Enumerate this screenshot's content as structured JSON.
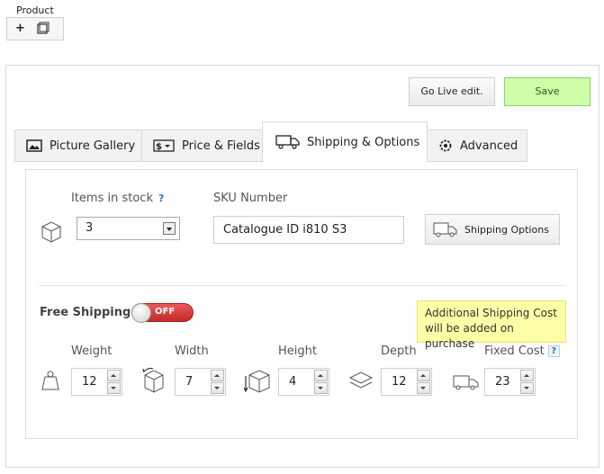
{
  "product_header": {
    "title": "Product"
  },
  "toolbar": {
    "live_edit_label": "Go Live edit.",
    "save_label": "Save"
  },
  "tabs": [
    {
      "label": "Picture Gallery",
      "icon": "picture-icon",
      "active": false
    },
    {
      "label": "Price & Fields",
      "icon": "price-icon",
      "active": false
    },
    {
      "label": "Shipping & Options",
      "icon": "truck-icon",
      "active": true
    },
    {
      "label": "Advanced",
      "icon": "gear-icon",
      "active": false
    }
  ],
  "stock": {
    "label": "Items in stock",
    "help": "?",
    "value": "3"
  },
  "sku": {
    "label": "SKU Number",
    "value": "Catalogue ID i810 S3"
  },
  "shipping_options_button": {
    "label": "Shipping Options"
  },
  "free_shipping": {
    "label": "Free Shipping",
    "toggle_text": "OFF",
    "state": "off"
  },
  "tooltip": {
    "text": "Additional Shipping Cost will be added on purchase"
  },
  "dimensions": [
    {
      "label": "Weight",
      "value": "12",
      "icon": "weight-icon"
    },
    {
      "label": "Width",
      "value": "7",
      "icon": "width-box-icon"
    },
    {
      "label": "Height",
      "value": "4",
      "icon": "height-box-icon"
    },
    {
      "label": "Depth",
      "value": "12",
      "icon": "depth-layers-icon"
    },
    {
      "label": "Fixed Cost",
      "value": "23",
      "icon": "truck-icon",
      "help": "?"
    }
  ],
  "colors": {
    "save_bg": "#ccffa8",
    "toggle_off": "#d63a3a",
    "tooltip_bg": "#ffffa8",
    "help": "#2a7ab8"
  }
}
